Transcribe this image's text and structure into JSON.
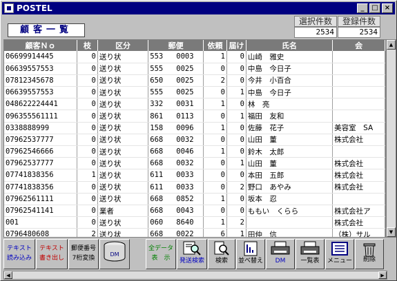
{
  "window": {
    "title": "POSTEL"
  },
  "header": {
    "title": "顧客一覧"
  },
  "stats": {
    "selected_label": "選択件数",
    "registered_label": "登録件数",
    "selected_value": "2534",
    "registered_value": "2534"
  },
  "table": {
    "columns": [
      "顧客Ｎｏ",
      "枝",
      "区分",
      "郵便",
      "依頼",
      "届け",
      "氏名",
      "会"
    ],
    "rows": [
      [
        "06699914445",
        "0",
        "送り状",
        "553",
        "0003",
        "1",
        "0",
        "山崎　雅史",
        ""
      ],
      [
        "06639557553",
        "0",
        "送り状",
        "555",
        "0025",
        "0",
        "0",
        "中島　今日子",
        ""
      ],
      [
        "07812345678",
        "0",
        "送り状",
        "650",
        "0025",
        "2",
        "0",
        "今井　小百合",
        ""
      ],
      [
        "06639557553",
        "0",
        "送り状",
        "555",
        "0025",
        "0",
        "1",
        "中島　今日子",
        ""
      ],
      [
        "048622224441",
        "0",
        "送り状",
        "332",
        "0031",
        "1",
        "0",
        "林　亮",
        ""
      ],
      [
        "096355561111",
        "0",
        "送り状",
        "861",
        "0113",
        "0",
        "1",
        "福田　友和",
        ""
      ],
      [
        "0338888999",
        "0",
        "送り状",
        "158",
        "0096",
        "1",
        "0",
        "佐藤　花子",
        "美容室　SA"
      ],
      [
        "07962537777",
        "0",
        "送り状",
        "668",
        "0032",
        "0",
        "0",
        "山田　董",
        "株式会社"
      ],
      [
        "07962546666",
        "0",
        "送り状",
        "668",
        "0046",
        "1",
        "0",
        "鈴木　太郎",
        ""
      ],
      [
        "07962537777",
        "0",
        "送り状",
        "668",
        "0032",
        "0",
        "1",
        "山田　董",
        "株式会社"
      ],
      [
        "07741838356",
        "1",
        "送り状",
        "611",
        "0033",
        "0",
        "0",
        "本田　五郎",
        "株式会社"
      ],
      [
        "07741838356",
        "0",
        "送り状",
        "611",
        "0033",
        "0",
        "2",
        "野口　あやみ",
        "株式会社"
      ],
      [
        "07962561111",
        "0",
        "送り状",
        "668",
        "0852",
        "1",
        "0",
        "坂本　忍",
        ""
      ],
      [
        "07962541141",
        "0",
        "業者",
        "668",
        "0043",
        "0",
        "0",
        "ももい　くらら",
        "株式会社ア"
      ],
      [
        "001",
        "0",
        "送り状",
        "060",
        "8640",
        "1",
        "2",
        "",
        "株式会社"
      ],
      [
        "0796480608",
        "2",
        "送り状",
        "668",
        "0022",
        "6",
        "1",
        "田仲　信",
        "（株）サル"
      ]
    ]
  },
  "toolbar": {
    "text_import": [
      "テキスト",
      "読み込み"
    ],
    "text_export": [
      "テキスト",
      "書き出し"
    ],
    "postal_convert": [
      "郵便番号",
      "7桁変換"
    ],
    "dm": "DM",
    "show_all": [
      "全データ",
      "表　示"
    ],
    "send_search": "発送検索",
    "search": "検索",
    "sort": "並べ替え",
    "dm_print": "DM",
    "list_print": "一覧表",
    "menu": "メニュー",
    "delete": "削除"
  },
  "colors": {
    "titlebar": "#000080",
    "header_bg": "#7a7a7a",
    "selected": "#000080"
  }
}
